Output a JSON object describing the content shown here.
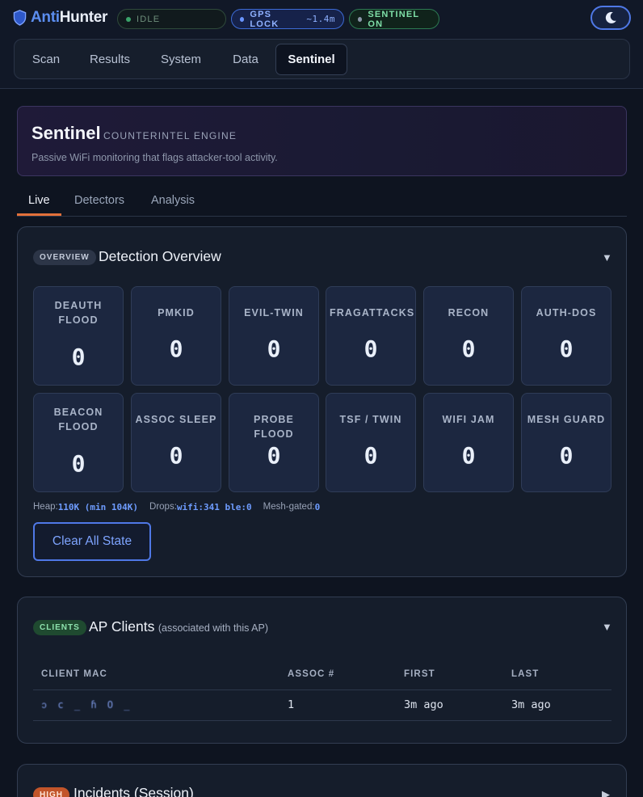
{
  "header": {
    "brand_a": "Anti",
    "brand_b": "Hunter",
    "status_idle": "IDLE",
    "gps_label": "GPS LOCK",
    "gps_accuracy": "~1.4m",
    "sentinel_status": "SENTINEL ON",
    "icons": {
      "brand": "shield-icon",
      "theme": "moon-icon"
    }
  },
  "nav": {
    "items": [
      "Scan",
      "Results",
      "System",
      "Data",
      "Sentinel"
    ],
    "active": "Sentinel"
  },
  "hero": {
    "title": "Sentinel",
    "subtitle": "COUNTERINTEL ENGINE",
    "description": "Passive WiFi monitoring that flags attacker-tool activity."
  },
  "subtabs": {
    "items": [
      "Live",
      "Detectors",
      "Analysis"
    ],
    "active": "Live"
  },
  "overview": {
    "badge": "OVERVIEW",
    "title": "Detection Overview",
    "toggle": "▼",
    "tiles": [
      {
        "label": "DEAUTH FLOOD",
        "value": "0"
      },
      {
        "label": "PMKID",
        "value": "0"
      },
      {
        "label": "EVIL-TWIN",
        "value": "0"
      },
      {
        "label": "FRAGATTACKS",
        "value": "0"
      },
      {
        "label": "RECON",
        "value": "0"
      },
      {
        "label": "AUTH-DOS",
        "value": "0"
      },
      {
        "label": "BEACON FLOOD",
        "value": "0"
      },
      {
        "label": "ASSOC SLEEP",
        "value": "0"
      },
      {
        "label": "PROBE FLOOD",
        "value": "0"
      },
      {
        "label": "TSF / TWIN",
        "value": "0"
      },
      {
        "label": "WIFI JAM",
        "value": "0"
      },
      {
        "label": "MESH GUARD",
        "value": "0"
      }
    ],
    "stats": {
      "heap_label": "Heap:",
      "heap_value": "110K (min 104K)",
      "drops_label": "Drops:",
      "drops_value": "wifi:341 ble:0",
      "mesh_label": "Mesh-gated:",
      "mesh_value": "0"
    },
    "clear_button": "Clear All State"
  },
  "clients": {
    "badge": "CLIENTS",
    "title": "AP Clients",
    "subtitle": "(associated with this AP)",
    "toggle": "▼",
    "columns": [
      "CLIENT MAC",
      "ASSOC #",
      "FIRST",
      "LAST"
    ],
    "rows": [
      {
        "mac": "ↄ c _   ɦ O _",
        "assoc": "1",
        "first": "3m ago",
        "last": "3m ago"
      }
    ]
  },
  "incidents": {
    "badge": "HIGH",
    "title": "Incidents (Session)",
    "toggle": "▶"
  },
  "colors": {
    "accent_blue": "#4f78e6",
    "tab_underline": "#e2703a",
    "sentinel_green": "#7fe0a8",
    "high_badge": "#c2552a"
  }
}
